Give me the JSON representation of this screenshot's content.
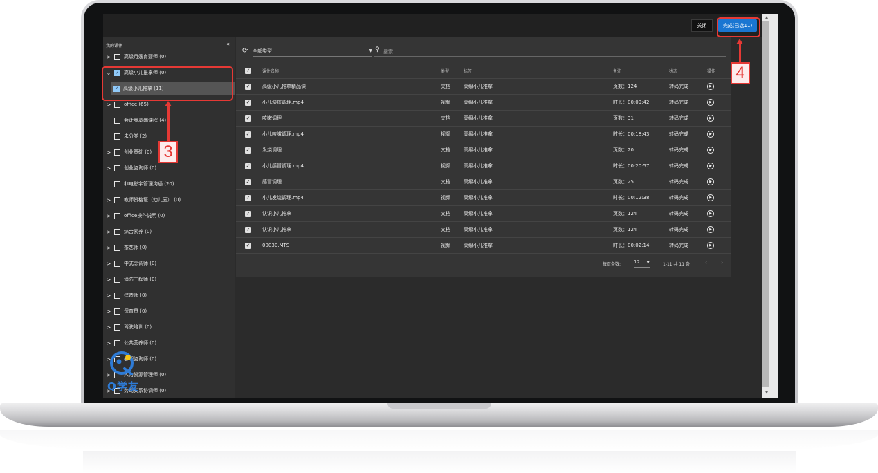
{
  "topbar": {
    "close_label": "关闭",
    "done_label": "完成(已选11)"
  },
  "sidebar": {
    "title": "我的课件",
    "collapse_label": "«",
    "items": [
      {
        "label": "高级月嫂育婴师 (0)",
        "expand": ">",
        "checked": false
      },
      {
        "label": "高级小儿推拿师 (0)",
        "expand": "v",
        "checked": true
      },
      {
        "label": "高级小儿推拿 (11)",
        "expand": "",
        "checked": true,
        "child": true
      },
      {
        "label": "office (65)",
        "expand": ">",
        "checked": false
      },
      {
        "label": "会计零基础课程 (4)",
        "expand": "",
        "checked": false
      },
      {
        "label": "未分类 (2)",
        "expand": "",
        "checked": false
      },
      {
        "label": "创业基础 (0)",
        "expand": ">",
        "checked": false
      },
      {
        "label": "创业咨询师 (0)",
        "expand": ">",
        "checked": false
      },
      {
        "label": "非电影字管理沟通 (20)",
        "expand": "",
        "checked": false
      },
      {
        "label": "教师资格证（幼儿园） (0)",
        "expand": ">",
        "checked": false
      },
      {
        "label": "office操作说明 (0)",
        "expand": ">",
        "checked": false
      },
      {
        "label": "综合素养 (0)",
        "expand": ">",
        "checked": false
      },
      {
        "label": "茶艺师 (0)",
        "expand": ">",
        "checked": false
      },
      {
        "label": "中式烹调师 (0)",
        "expand": ">",
        "checked": false
      },
      {
        "label": "消防工程师 (0)",
        "expand": ">",
        "checked": false
      },
      {
        "label": "建造师 (0)",
        "expand": ">",
        "checked": false
      },
      {
        "label": "保育员 (0)",
        "expand": ">",
        "checked": false
      },
      {
        "label": "驾驶培训 (0)",
        "expand": ">",
        "checked": false
      },
      {
        "label": "公共营养师 (0)",
        "expand": ">",
        "checked": false
      },
      {
        "label": "心理咨询师 (0)",
        "expand": ">",
        "checked": false
      },
      {
        "label": "人力资源管理师 (0)",
        "expand": ">",
        "checked": false
      },
      {
        "label": "劳动关系协调师 (0)",
        "expand": ">",
        "checked": false
      }
    ]
  },
  "toolbar": {
    "type_label": "全部类型",
    "search_placeholder": "搜索"
  },
  "table": {
    "headers": {
      "name": "课件名称",
      "type": "类型",
      "tag": "标签",
      "note": "备注",
      "status": "状态",
      "op": "操作"
    },
    "rows": [
      {
        "name": "高级小儿推拿精品课",
        "type": "文档",
        "tag": "高级小儿推拿",
        "note": "页数：124",
        "status": "转码完成"
      },
      {
        "name": "小儿湿疹调理.mp4",
        "type": "视频",
        "tag": "高级小儿推拿",
        "note": "时长：00:09:42",
        "status": "转码完成"
      },
      {
        "name": "咳嗽调理",
        "type": "文档",
        "tag": "高级小儿推拿",
        "note": "页数：31",
        "status": "转码完成"
      },
      {
        "name": "小儿咳嗽调理.mp4",
        "type": "视频",
        "tag": "高级小儿推拿",
        "note": "时长：00:18:43",
        "status": "转码完成"
      },
      {
        "name": "发烧调理",
        "type": "文档",
        "tag": "高级小儿推拿",
        "note": "页数：20",
        "status": "转码完成"
      },
      {
        "name": "小儿感冒调理.mp4",
        "type": "视频",
        "tag": "高级小儿推拿",
        "note": "时长：00:20:57",
        "status": "转码完成"
      },
      {
        "name": "感冒调理",
        "type": "文档",
        "tag": "高级小儿推拿",
        "note": "页数：25",
        "status": "转码完成"
      },
      {
        "name": "小儿发烧调理.mp4",
        "type": "视频",
        "tag": "高级小儿推拿",
        "note": "时长：00:12:38",
        "status": "转码完成"
      },
      {
        "name": "认识小儿推拿",
        "type": "文档",
        "tag": "高级小儿推拿",
        "note": "页数：124",
        "status": "转码完成"
      },
      {
        "name": "认识小儿推拿",
        "type": "文档",
        "tag": "高级小儿推拿",
        "note": "页数：124",
        "status": "转码完成"
      },
      {
        "name": "00030.MTS",
        "type": "视频",
        "tag": "高级小儿推拿",
        "note": "时长：00:02:14",
        "status": "转码完成"
      }
    ]
  },
  "pagination": {
    "per_page_label": "每页条数:",
    "per_page_value": "12",
    "range_label": "1-11 共 11 条"
  },
  "annotations": {
    "step3": "3",
    "step4": "4"
  },
  "watermark": {
    "text": "Q学友"
  },
  "colors": {
    "accent": "#1976d2",
    "highlight": "#e53935"
  }
}
